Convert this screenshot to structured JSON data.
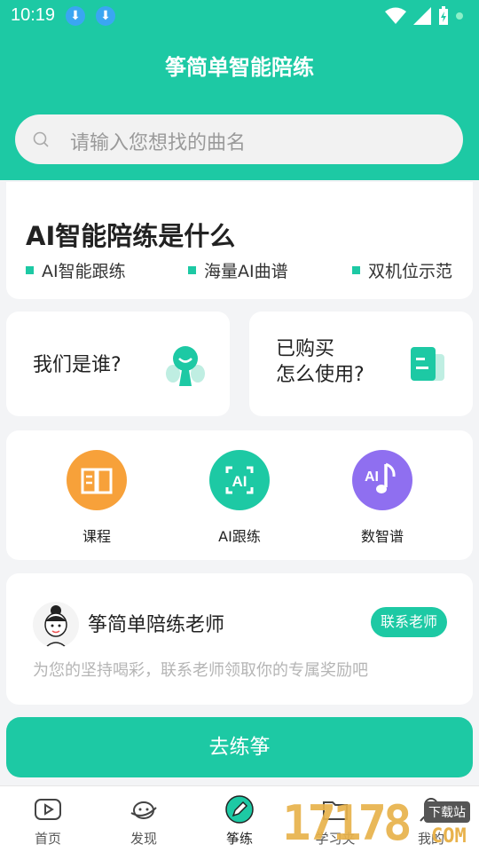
{
  "status_bar": {
    "time": "10:19"
  },
  "header": {
    "title": "筝简单智能陪练"
  },
  "search": {
    "placeholder": "请输入您想找的曲名"
  },
  "intro": {
    "title": "AI智能陪练是什么",
    "bullets": [
      "AI智能跟练",
      "海量AI曲谱",
      "双机位示范"
    ]
  },
  "who_card": {
    "label": "我们是谁?"
  },
  "bought_card": {
    "line1": "已购买",
    "line2": "怎么使用?"
  },
  "features": [
    {
      "label": "课程",
      "icon": "book-icon",
      "color": "#f7a13a"
    },
    {
      "label": "AI跟练",
      "icon": "ai-scan-icon",
      "color": "#1dc9a4"
    },
    {
      "label": "数智谱",
      "icon": "ai-music-note-icon",
      "color": "#8f6ff0"
    }
  ],
  "teacher": {
    "name": "筝简单陪练老师",
    "contact_label": "联系老师",
    "description": "为您的坚持喝彩，联系老师领取你的专属奖励吧"
  },
  "cta": {
    "label": "去练筝"
  },
  "tabs": [
    {
      "label": "首页",
      "icon": "video-play-icon"
    },
    {
      "label": "发现",
      "icon": "planet-icon"
    },
    {
      "label": "筝练",
      "icon": "pencil-icon",
      "active": true
    },
    {
      "label": "学习夹",
      "icon": "folder-icon"
    },
    {
      "label": "我的",
      "icon": "user-icon"
    }
  ],
  "watermark": {
    "text": "17178",
    "badge": "下载站",
    "suffix": "COM"
  },
  "colors": {
    "accent": "#1dc9a4",
    "orange": "#f7a13a",
    "purple": "#8f6ff0"
  }
}
